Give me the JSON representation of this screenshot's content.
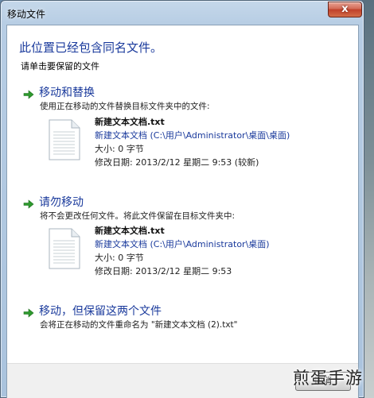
{
  "window": {
    "title": "移动文件",
    "close_label": "x"
  },
  "header": {
    "heading": "此位置已经包含同名文件。",
    "subheading": "请单击要保留的文件"
  },
  "options": [
    {
      "title": "移动和替换",
      "description": "使用正在移动的文件替换目标文件夹中的文件:",
      "file": {
        "name": "新建文本文档.txt",
        "path": "新建文本文档 (C:\\用户\\Administrator\\桌面\\桌面)",
        "size": "大小: 0 字节",
        "modified": "修改日期: 2013/2/12 星期二 9:53 (较新)"
      }
    },
    {
      "title": "请勿移动",
      "description": "将不会更改任何文件。将此文件保留在目标文件夹中:",
      "file": {
        "name": "新建文本文档.txt",
        "path": "新建文本文档 (C:\\用户\\Administrator\\桌面)",
        "size": "大小: 0 字节",
        "modified": "修改日期: 2013/2/12 星期二 9:53"
      }
    },
    {
      "title": "移动，但保留这两个文件",
      "description": "会将正在移动的文件重命名为 \"新建文本文档 (2).txt\""
    }
  ],
  "footer": {
    "cancel_label": "取消"
  },
  "watermark": "煎蛋手游",
  "icons": {
    "option_arrow": "green-arrow-icon",
    "file": "text-file-icon"
  },
  "colors": {
    "link_blue": "#1a3a9c",
    "arrow_green": "#2e9a2e"
  }
}
